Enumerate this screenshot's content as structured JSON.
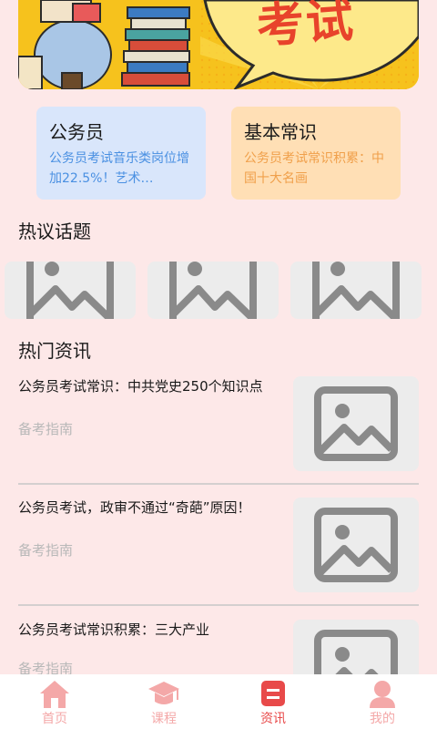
{
  "banner": {
    "text": "考试",
    "colors": {
      "bg": "#f6c21d",
      "bubble": "#fde98a",
      "text": "#e8432b"
    }
  },
  "cards": [
    {
      "title": "公务员",
      "desc": "公务员考试音乐类岗位增加22.5%！艺术…",
      "accent": "#4a90e2",
      "bg": "#d9e6fb"
    },
    {
      "title": "基本常识",
      "desc": "公务员考试常识积累：中国十大名画",
      "accent": "#f0a04b",
      "bg": "#ffdfb5"
    }
  ],
  "sections": {
    "hot_topics": "热议话题",
    "hot_news": "热门资讯"
  },
  "news": [
    {
      "title": "公务员考试常识：中共党史250个知识点",
      "source": "备考指南"
    },
    {
      "title": "公务员考试，政审不通过“奇葩”原因！",
      "source": "备考指南"
    },
    {
      "title": "公务员考试常识积累：三大产业",
      "source": "备考指南"
    }
  ],
  "tabs": [
    {
      "label": "首页",
      "icon": "home-icon"
    },
    {
      "label": "课程",
      "icon": "graduation-cap-icon"
    },
    {
      "label": "资讯",
      "icon": "news-icon",
      "active": true
    },
    {
      "label": "我的",
      "icon": "user-icon"
    }
  ],
  "colors": {
    "page_bg": "#fde8e8",
    "tab_active": "#e84a4a",
    "tab_inactive": "#f4a8a8",
    "placeholder_bg": "#ececec",
    "placeholder_icon": "#8a8a8a"
  }
}
